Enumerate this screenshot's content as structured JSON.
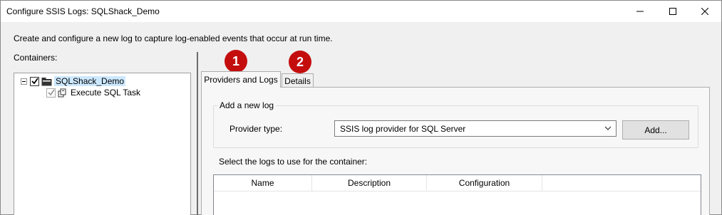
{
  "window": {
    "title": "Configure SSIS Logs: SQLShack_Demo",
    "controls": [
      "minimize-icon",
      "maximize-icon",
      "close-icon"
    ]
  },
  "intro_text": "Create and configure a new log to capture log-enabled events that occur at run time.",
  "containers": {
    "label": "Containers:",
    "tree": [
      {
        "label": "SQLShack_Demo",
        "checked": true,
        "expanded": true,
        "selected": true,
        "icon": "package-folder-icon"
      },
      {
        "label": "Execute SQL Task",
        "checked": true,
        "dimmed": true,
        "icon": "execute-sql-task-icon"
      }
    ]
  },
  "callouts": {
    "one": "1",
    "two": "2",
    "color": "#c40e0e"
  },
  "tabs": [
    {
      "label": "Providers and Logs",
      "active": true
    },
    {
      "label": "Details",
      "active": false
    }
  ],
  "add_log": {
    "group_title": "Add a new log",
    "provider_label": "Provider type:",
    "provider_value": "SSIS log provider for SQL Server",
    "add_button": "Add..."
  },
  "logs": {
    "label": "Select the logs to use for the container:",
    "columns": [
      "Name",
      "Description",
      "Configuration"
    ]
  }
}
